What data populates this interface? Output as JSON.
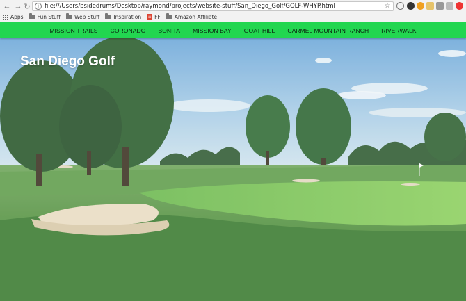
{
  "browser": {
    "url": "file:///Users/bsidedrums/Desktop/raymond/projects/website-stuff/San_Diego_Golf/GOLF-WHYP.html",
    "bookmarks": [
      {
        "label": "Apps",
        "icon": "apps-grid-icon"
      },
      {
        "label": "Fun Stuff",
        "icon": "folder-icon"
      },
      {
        "label": "Web Stuff",
        "icon": "folder-icon"
      },
      {
        "label": "Inspiration",
        "icon": "folder-icon"
      },
      {
        "label": "FF",
        "icon": "ff-icon"
      },
      {
        "label": "Amazon Affiliate",
        "icon": "folder-icon"
      }
    ]
  },
  "navbar": {
    "color": "#22d650",
    "links": [
      "MISSION TRAILS",
      "CORONADO",
      "BONITA",
      "MISSION BAY",
      "GOAT HILL",
      "CARMEL MOUNTAIN RANCH",
      "RIVERWALK"
    ]
  },
  "hero": {
    "title": "San Diego Golf"
  }
}
